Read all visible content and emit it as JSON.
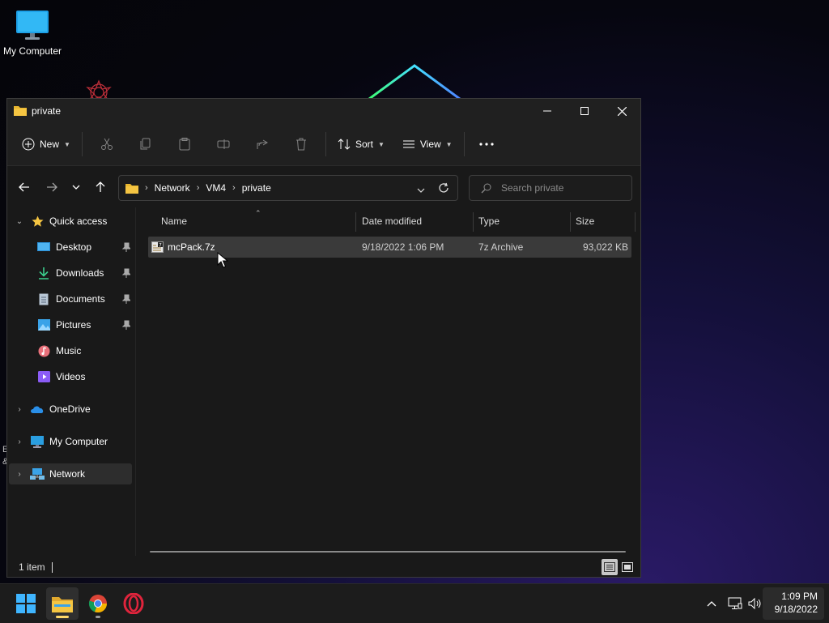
{
  "desktop": {
    "icons": [
      {
        "label": "My Computer",
        "icon": "monitor-icon"
      }
    ],
    "edge_text": [
      "E",
      "&"
    ]
  },
  "window": {
    "title": "private",
    "controls": {
      "minimize": "minimize-icon",
      "maximize": "maximize-icon",
      "close": "close-icon"
    },
    "commandbar": {
      "new_label": "New",
      "sort_label": "Sort",
      "view_label": "View",
      "disabled_actions": [
        "cut-icon",
        "copy-icon",
        "paste-icon",
        "rename-icon",
        "share-icon",
        "delete-icon"
      ],
      "more": "more-icon"
    },
    "address": {
      "breadcrumbs": [
        "Network",
        "VM4",
        "private"
      ]
    },
    "search": {
      "placeholder": "Search private"
    },
    "navpane": {
      "quick_access": "Quick access",
      "items": [
        {
          "label": "Desktop",
          "icon": "desktop-icon",
          "pinned": true
        },
        {
          "label": "Downloads",
          "icon": "downloads-icon",
          "pinned": true
        },
        {
          "label": "Documents",
          "icon": "documents-icon",
          "pinned": true
        },
        {
          "label": "Pictures",
          "icon": "pictures-icon",
          "pinned": true
        },
        {
          "label": "Music",
          "icon": "music-icon",
          "pinned": false
        },
        {
          "label": "Videos",
          "icon": "videos-icon",
          "pinned": false
        }
      ],
      "roots": [
        {
          "label": "OneDrive",
          "icon": "onedrive-icon"
        },
        {
          "label": "My Computer",
          "icon": "computer-icon"
        },
        {
          "label": "Network",
          "icon": "network-icon",
          "selected": true
        }
      ]
    },
    "columns": [
      "Name",
      "Date modified",
      "Type",
      "Size"
    ],
    "files": [
      {
        "name": "mcPack.7z",
        "modified": "9/18/2022 1:06 PM",
        "type": "7z Archive",
        "size": "93,022 KB"
      }
    ],
    "status": {
      "item_count": "1 item"
    }
  },
  "taskbar": {
    "apps": [
      "start-icon",
      "file-explorer-icon",
      "chrome-icon",
      "opera-icon"
    ],
    "time": "1:09 PM",
    "date": "9/18/2022"
  },
  "colors": {
    "accent": "#ffd869",
    "folder": "#f5c542",
    "selected_row": "#3a3a3a",
    "window_bg": "#191919"
  }
}
